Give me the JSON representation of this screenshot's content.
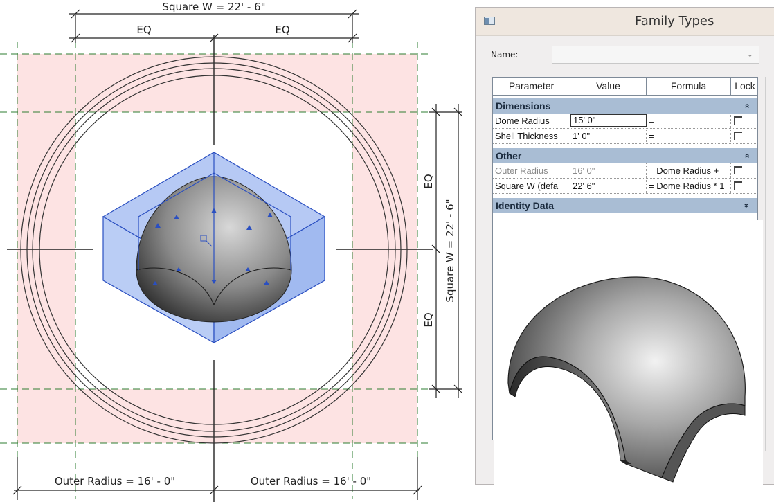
{
  "drawing": {
    "top_dim": "Square W = 22' - 6\"",
    "top_eq_left": "EQ",
    "top_eq_right": "EQ",
    "right_dim": "Square W = 22' - 6\"",
    "right_eq_upper": "EQ",
    "right_eq_lower": "EQ",
    "bottom_left_dim": "Outer Radius = 16' - 0\"",
    "bottom_right_dim": "Outer Radius = 16' - 0\""
  },
  "dialog": {
    "title": "Family Types",
    "name_label": "Name:",
    "name_value": "",
    "columns": [
      "Parameter",
      "Value",
      "Formula",
      "Lock"
    ],
    "groups": [
      {
        "label": "Dimensions",
        "chevron": "»"
      },
      {
        "label": "Other",
        "chevron": "»"
      },
      {
        "label": "Identity Data",
        "chevron": "»"
      }
    ],
    "rows": [
      {
        "param": "Dome Radius",
        "value": "15'  0\"",
        "formula": "="
      },
      {
        "param": "Shell Thickness",
        "value": "1'  0\"",
        "formula": "="
      },
      {
        "param": "Outer Radius",
        "value": "16'  0\"",
        "formula": "= Dome Radius +"
      },
      {
        "param": "Square W (defa",
        "value": "22'  6\"",
        "formula": "= Dome Radius * 1"
      }
    ]
  },
  "colors": {
    "pink_zone": "#fde3e3",
    "selection_blue": "#3c63d6",
    "group_header": "#a9bdd4"
  }
}
